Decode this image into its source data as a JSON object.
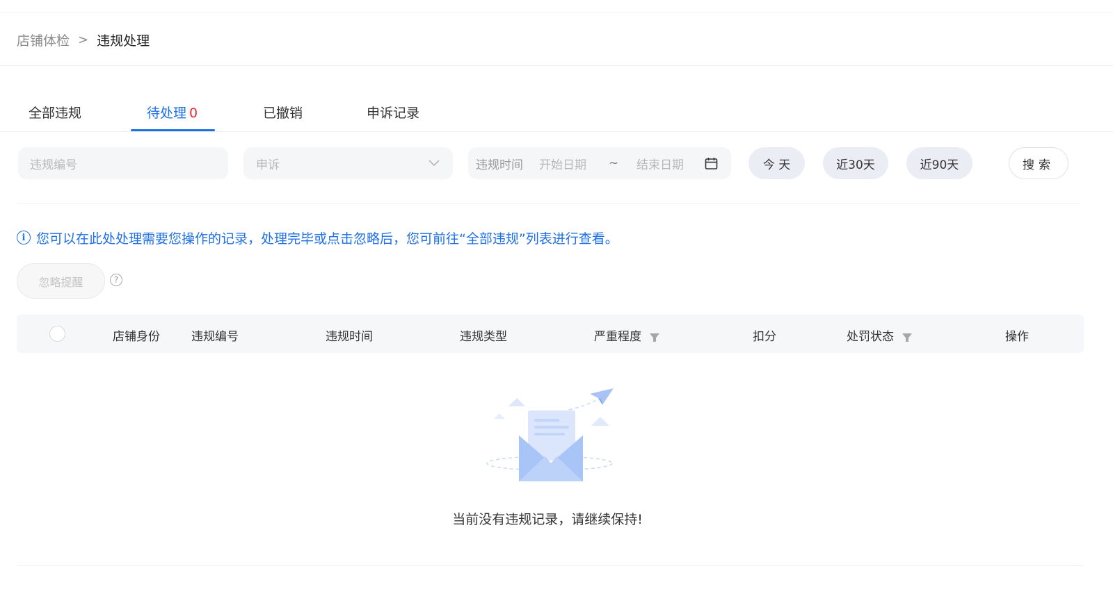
{
  "breadcrumb": {
    "parent": "店铺体检",
    "separator": ">",
    "current": "违规处理"
  },
  "tabs": [
    {
      "label": "全部违规"
    },
    {
      "label": "待处理",
      "count": "0"
    },
    {
      "label": "已撤销"
    },
    {
      "label": "申诉记录"
    }
  ],
  "filters": {
    "violation_no_placeholder": "违规编号",
    "appeal_select_value": "申诉",
    "time_label": "违规时间",
    "start_placeholder": "开始日期",
    "range_sep": "~",
    "end_placeholder": "结束日期",
    "quick": [
      "今 天",
      "近30天",
      "近90天"
    ],
    "search": "搜索"
  },
  "notice": {
    "icon": "info-icon",
    "text": "您可以在此处处理需要您操作的记录，处理完毕或点击忽略后，您可前往“全部违规”列表进行查看。"
  },
  "ignore_button": "忽略提醒",
  "table": {
    "headers": [
      "店铺身份",
      "违规编号",
      "违规时间",
      "违规类型",
      "严重程度",
      "扣分",
      "处罚状态",
      "操作"
    ]
  },
  "empty": {
    "text": "当前没有违规记录，请继续保持!"
  },
  "colors": {
    "primary": "#1f6fe5",
    "count": "#f5222d"
  }
}
